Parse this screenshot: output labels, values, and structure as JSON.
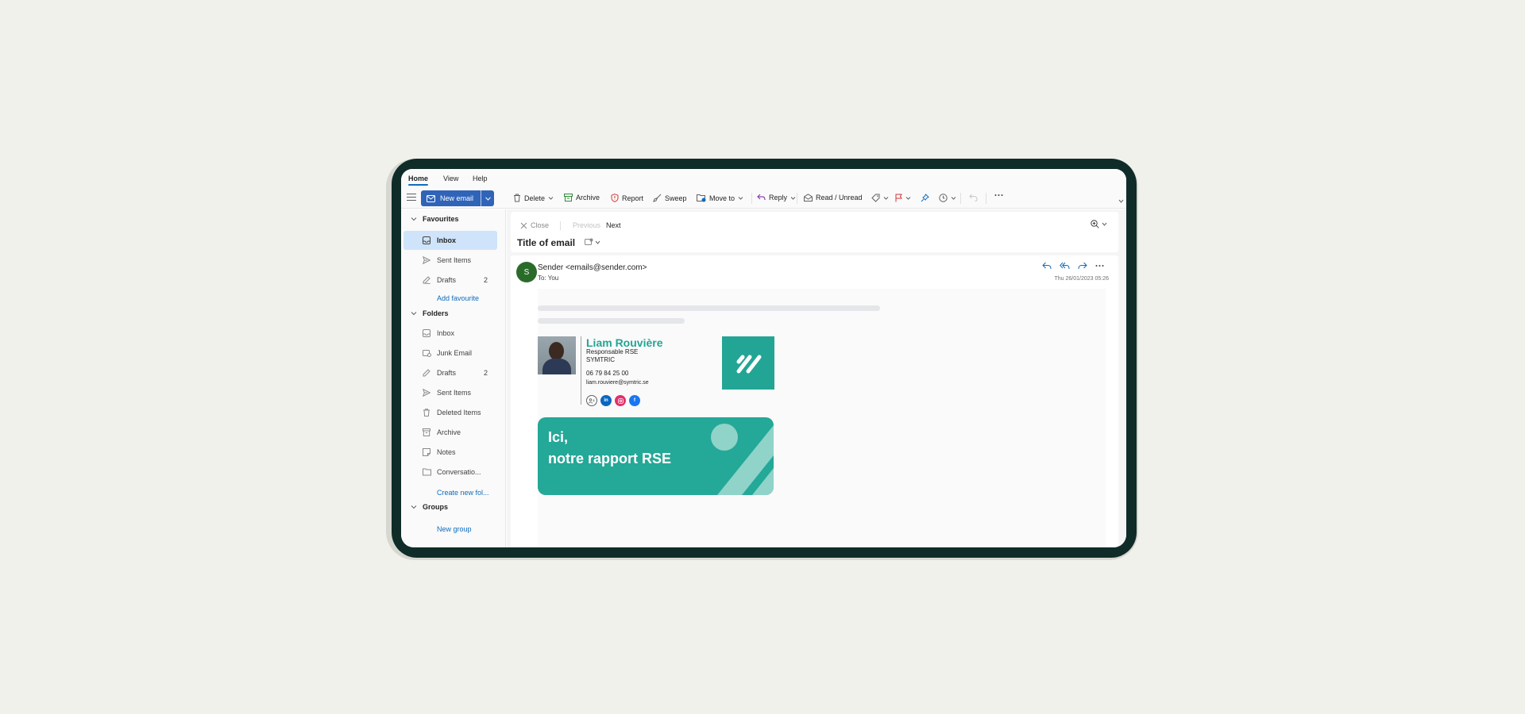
{
  "ribbon": {
    "tabs": [
      {
        "label": "Home",
        "active": true
      },
      {
        "label": "View",
        "active": false
      },
      {
        "label": "Help",
        "active": false
      }
    ]
  },
  "toolbar": {
    "new_email": "New email",
    "delete": "Delete",
    "archive": "Archive",
    "report": "Report",
    "sweep": "Sweep",
    "move_to": "Move to",
    "reply": "Reply",
    "read_unread": "Read / Unread"
  },
  "sidebar": {
    "favourites": {
      "header": "Favourites",
      "items": [
        {
          "label": "Inbox",
          "count": "",
          "icon": "inbox-icon",
          "active": true
        },
        {
          "label": "Sent Items",
          "count": "",
          "icon": "send-icon",
          "active": false
        },
        {
          "label": "Drafts",
          "count": "2",
          "icon": "pencil-icon",
          "active": false
        }
      ],
      "add_link": "Add favourite"
    },
    "folders": {
      "header": "Folders",
      "items": [
        {
          "label": "Inbox",
          "count": "",
          "icon": "inbox-icon"
        },
        {
          "label": "Junk Email",
          "count": "",
          "icon": "junk-icon"
        },
        {
          "label": "Drafts",
          "count": "2",
          "icon": "pencil-icon"
        },
        {
          "label": "Sent Items",
          "count": "",
          "icon": "send-icon"
        },
        {
          "label": "Deleted Items",
          "count": "",
          "icon": "trash-icon"
        },
        {
          "label": "Archive",
          "count": "",
          "icon": "archive-icon"
        },
        {
          "label": "Notes",
          "count": "",
          "icon": "note-icon"
        },
        {
          "label": "Conversatio...",
          "count": "",
          "icon": "folder-icon"
        }
      ],
      "create_link": "Create new fol..."
    },
    "groups": {
      "header": "Groups",
      "new_group": "New group"
    }
  },
  "reading_pane": {
    "close": "Close",
    "previous": "Previous",
    "next": "Next",
    "title": "Title of email",
    "message": {
      "avatar_initial": "S",
      "sender": "Sender <emails@sender.com>",
      "to_label": "To:",
      "to_value": "You",
      "date": "Thu 26/01/2023 05:26"
    }
  },
  "signature": {
    "name": "Liam Rouvière",
    "role": "Responsable RSE",
    "company": "SYMTRIC",
    "phone": "06 79 84 25 00",
    "email": "liam.rouviere@symtric.se",
    "socials": [
      "contact-icon",
      "linkedin-icon",
      "instagram-icon",
      "facebook-icon"
    ],
    "social_glyphs": {
      "linkedin": "in",
      "facebook": "f"
    }
  },
  "banner": {
    "line1": "Ici,",
    "line2": "notre rapport RSE"
  },
  "colors": {
    "accent": "#0f6cbd",
    "new_email_bg": "#2f64b9",
    "brand_teal": "#22a594",
    "device_frame": "#0f2c29",
    "avatar": "#2a6b2a"
  }
}
